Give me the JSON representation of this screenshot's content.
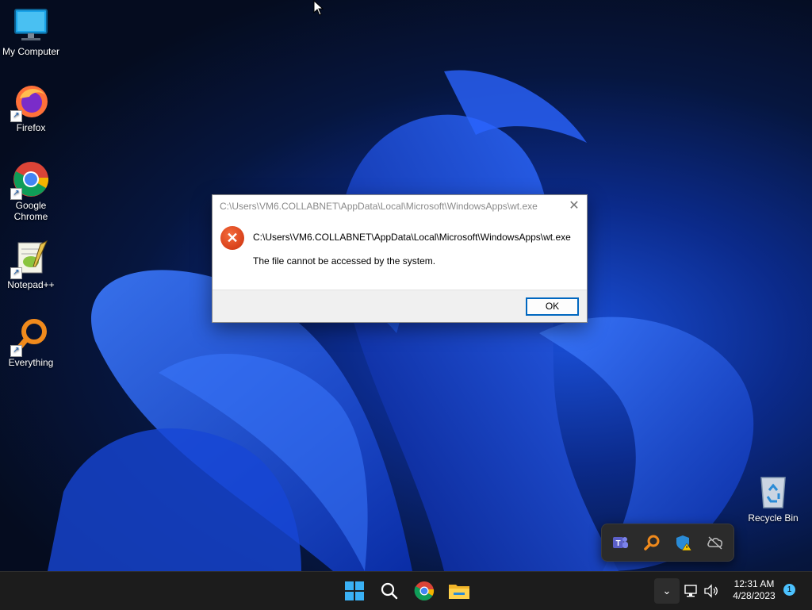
{
  "desktop": {
    "icons": [
      {
        "label": "My Computer"
      },
      {
        "label": "Firefox"
      },
      {
        "label": "Google Chrome"
      },
      {
        "label": "Notepad++"
      },
      {
        "label": "Everything"
      },
      {
        "label": "Recycle Bin"
      }
    ]
  },
  "dialog": {
    "title": "C:\\Users\\VM6.COLLABNET\\AppData\\Local\\Microsoft\\WindowsApps\\wt.exe",
    "path": "C:\\Users\\VM6.COLLABNET\\AppData\\Local\\Microsoft\\WindowsApps\\wt.exe",
    "message": "The file cannot be accessed by the system.",
    "ok_label": "OK",
    "close_glyph": "✕",
    "error_glyph": "✕"
  },
  "tray_flyout": {
    "icons": [
      "teams-icon",
      "everything-search-icon",
      "defender-warning-icon",
      "onedrive-off-icon"
    ]
  },
  "taskbar": {
    "pinned": [
      "start-icon",
      "search-icon",
      "chrome-icon",
      "file-explorer-icon"
    ],
    "chevron_glyph": "⌄",
    "time": "12:31 AM",
    "date": "4/28/2023",
    "notification_count": "1"
  },
  "colors": {
    "accent": "#0067c0",
    "error": "#d8411a",
    "taskbar": "#1c1c1c"
  }
}
